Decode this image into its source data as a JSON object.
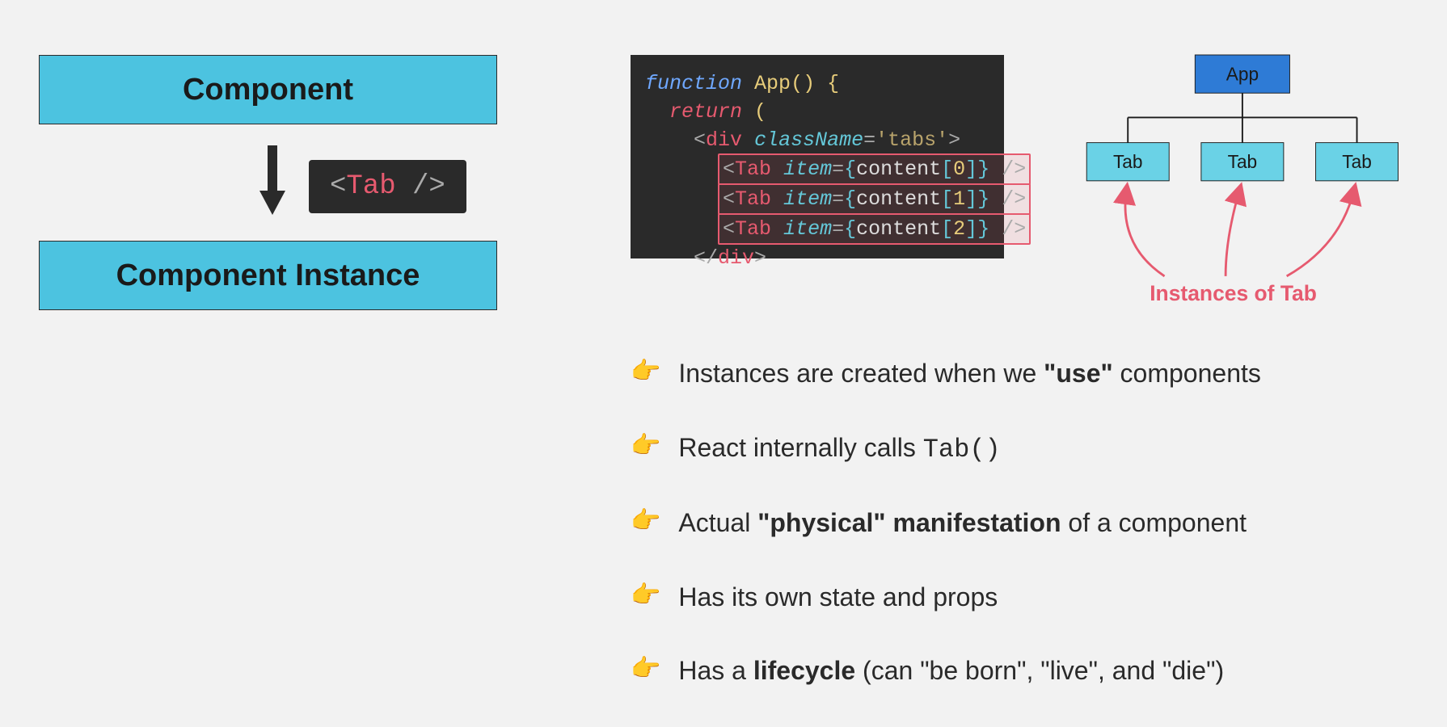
{
  "left": {
    "component_label": "Component",
    "instance_label": "Component Instance",
    "tab_chip_open": "<",
    "tab_chip_name": "Tab",
    "tab_chip_close": " />"
  },
  "code": {
    "function_kw": "function",
    "fn_name": "App",
    "parens": "()",
    "brace_open": "{",
    "return_kw": "return",
    "paren_open": "(",
    "div_open_lt": "<",
    "div_tag": "div",
    "classname_attr": "className",
    "eq": "=",
    "classname_val": "'tabs'",
    "gt": ">",
    "tabs": [
      {
        "lt": "<",
        "name": "Tab",
        "attr": "item",
        "eq": "=",
        "lb": "{",
        "ident": "content",
        "ob": "[",
        "num": "0",
        "cb": "]",
        "rb": "}",
        "close": " />"
      },
      {
        "lt": "<",
        "name": "Tab",
        "attr": "item",
        "eq": "=",
        "lb": "{",
        "ident": "content",
        "ob": "[",
        "num": "1",
        "cb": "]",
        "rb": "}",
        "close": " />"
      },
      {
        "lt": "<",
        "name": "Tab",
        "attr": "item",
        "eq": "=",
        "lb": "{",
        "ident": "content",
        "ob": "[",
        "num": "2",
        "cb": "]",
        "rb": "}",
        "close": " />"
      }
    ],
    "div_close": "</",
    "div_close_tag": "div",
    "div_close_gt": ">"
  },
  "tree": {
    "root": "App",
    "children": [
      "Tab",
      "Tab",
      "Tab"
    ],
    "caption": "Instances of Tab"
  },
  "bullets": [
    {
      "pre": "Instances are created when we ",
      "bold": "\"use\"",
      "post": " components"
    },
    {
      "pre": "React internally calls ",
      "mono": "Tab()",
      "post": ""
    },
    {
      "pre": "Actual ",
      "bold": "\"physical\" manifestation",
      "post": " of a component"
    },
    {
      "pre": "Has its own state and props",
      "bold": "",
      "post": ""
    },
    {
      "pre": "Has a ",
      "bold": "lifecycle",
      "post": " (can \"be born\", \"live\", and \"die\")"
    }
  ],
  "icons": {
    "hand": "👉"
  }
}
